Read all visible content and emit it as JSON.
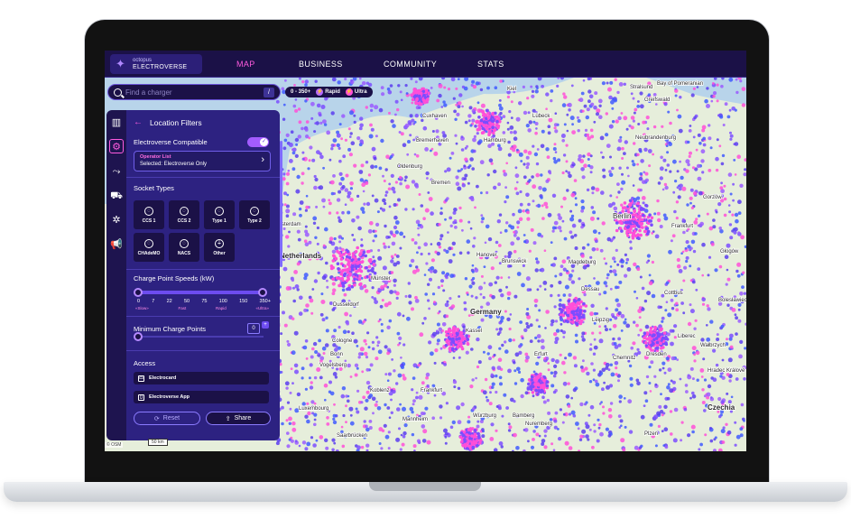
{
  "brand": {
    "line1": "octopus",
    "line2": "ELECTROVERSE"
  },
  "nav": [
    {
      "label": "MAP"
    },
    {
      "label": "BUSINESS"
    },
    {
      "label": "COMMUNITY"
    },
    {
      "label": "STATS"
    }
  ],
  "search": {
    "placeholder": "Find a charger",
    "shortcut": "/"
  },
  "chips": {
    "range": "0 - 350+",
    "rapid": "Rapid",
    "ultra": "Ultra"
  },
  "panel": {
    "title": "Location Filters",
    "electroverse_compatible": "Electroverse Compatible",
    "operator_title": "Operator List",
    "operator_selected": "Selected: Electroverse Only",
    "socket_types_title": "Socket Types",
    "sockets": [
      "CCS 1",
      "CCS 2",
      "Type 1",
      "Type 2",
      "CHAdeMO",
      "NACS",
      "Other"
    ],
    "speeds_title": "Charge Point Speeds (kW)",
    "speed_ticks": [
      "0",
      "7",
      "22",
      "50",
      "75",
      "100",
      "150",
      "350+"
    ],
    "speed_bands": [
      "«Slow»",
      "Fast",
      "Rapid",
      "«Ultra»"
    ],
    "speed_range": {
      "min": "0",
      "max": "350+"
    },
    "min_points_title": "Minimum Charge Points",
    "min_points_value": "0",
    "access_title": "Access",
    "access_items": [
      "Electrocard",
      "Electroverse App"
    ],
    "reset_label": "Reset",
    "share_label": "Share"
  },
  "map": {
    "labels": {
      "stralsund": "Stralsund",
      "greifswald": "Greifswald",
      "bay": "Bay of Pomeranian",
      "kiel": "Kiel",
      "lubeck": "Lübeck",
      "cuxhaven": "Cuxhaven",
      "bremerhaven": "Bremerhaven",
      "hamburg": "Hamburg",
      "neubrandenburg": "Neubrandenburg",
      "oldenburg": "Oldenburg",
      "bremen": "Bremen",
      "berlin": "Berlin",
      "frankfurt_oder": "Frankfurt",
      "amsterdam": "sterdam",
      "netherlands": "Netherlands",
      "hanover": "Hanover",
      "brunswick": "Brunswick",
      "magdeburg": "Magdeburg",
      "munster": "Münster",
      "dessau": "Dessau",
      "cottbus": "Cottbus",
      "duisburg": "Dusseldorf",
      "germany": "Germany",
      "kassel": "Kassel",
      "leipzig": "Leipzig",
      "dresden": "Dresden",
      "erfurt": "Erfurt",
      "cologne": "Cologne",
      "bonn": "Bonn",
      "koblenz": "Koblenz",
      "frankfurt": "Frankfurt",
      "chemnitz": "Chemnitz",
      "liberec": "Liberec",
      "luxembourg": "Luxembourg",
      "wurzburg": "Würzburg",
      "bamberg": "Bamberg",
      "czechia": "Czechia",
      "nuremberg": "Nuremberg",
      "plzen": "Plzen",
      "saarbrucken": "Saarbrücken",
      "mannheim": "Mannheim",
      "gorzow": "Gorzów",
      "glogow": "Głogów",
      "bolesławiec": "Bolesławiec",
      "walbrzych": "Wałbrzych",
      "hradec": "Hradec Králové",
      "vogelsberg": "Vogelsberg"
    },
    "scale_label": "50 km",
    "attribution": "© OSM"
  },
  "colors": {
    "accent_pink": "#ff4fd8",
    "accent_purple": "#7b4dff",
    "panel": "#2d2281",
    "nav": "#1b1147"
  }
}
